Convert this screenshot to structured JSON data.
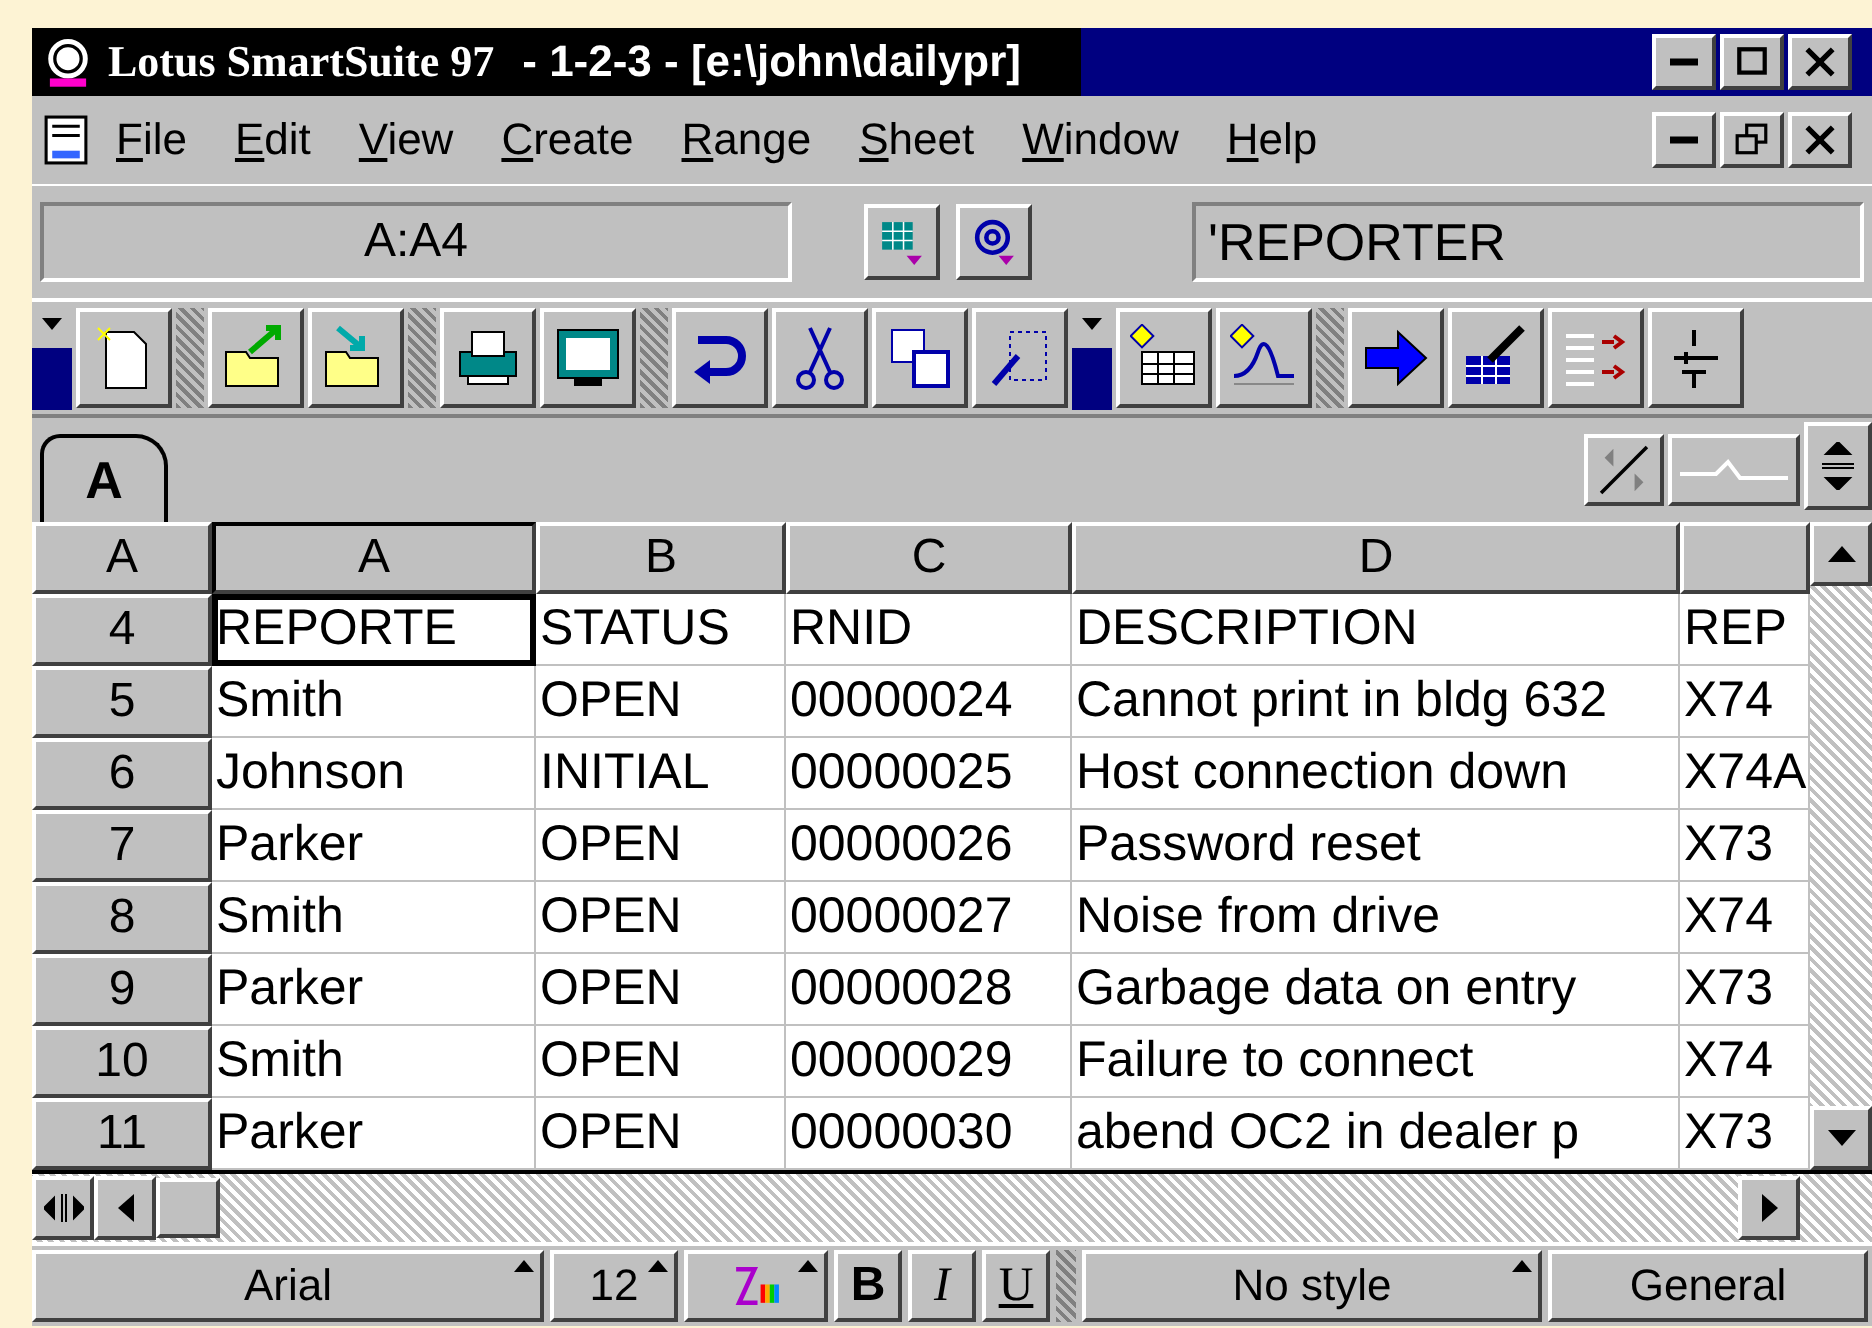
{
  "window": {
    "app": "Lotus SmartSuite 97",
    "document": "-  1-2-3 - [e:\\john\\dailypr]"
  },
  "menu": [
    "File",
    "Edit",
    "View",
    "Create",
    "Range",
    "Sheet",
    "Window",
    "Help"
  ],
  "edit_line": {
    "address": "A:A4",
    "contents": "'REPORTER"
  },
  "tabs": [
    {
      "label": "A",
      "selected": true
    }
  ],
  "sheet": {
    "corner": "A",
    "columns": [
      {
        "label": "A",
        "selected": true
      },
      {
        "label": "B",
        "selected": false
      },
      {
        "label": "C",
        "selected": false
      },
      {
        "label": "D",
        "selected": false
      },
      {
        "selected": false
      }
    ],
    "rows": [
      {
        "number": "4",
        "cells": [
          {
            "text": "REPORTE",
            "selected": true
          },
          {
            "text": "STATUS",
            "selected": false
          },
          {
            "text": "RNID",
            "selected": false
          },
          {
            "text": "DESCRIPTION",
            "selected": false
          },
          {
            "text": "REP",
            "selected": false
          }
        ]
      },
      {
        "number": "5",
        "cells": [
          {
            "text": "Smith",
            "selected": false
          },
          {
            "text": "OPEN",
            "selected": false
          },
          {
            "text": "00000024",
            "selected": false
          },
          {
            "text": "Cannot print in bldg 632",
            "selected": false
          },
          {
            "text": "X74",
            "selected": false
          }
        ]
      },
      {
        "number": "6",
        "cells": [
          {
            "text": "Johnson",
            "selected": false
          },
          {
            "text": "INITIAL",
            "selected": false
          },
          {
            "text": "00000025",
            "selected": false
          },
          {
            "text": "Host connection down",
            "selected": false
          },
          {
            "text": "X74A",
            "selected": false
          }
        ]
      },
      {
        "number": "7",
        "cells": [
          {
            "text": "Parker",
            "selected": false
          },
          {
            "text": "OPEN",
            "selected": false
          },
          {
            "text": "00000026",
            "selected": false
          },
          {
            "text": "Password reset",
            "selected": false
          },
          {
            "text": "X73",
            "selected": false
          }
        ]
      },
      {
        "number": "8",
        "cells": [
          {
            "text": "Smith",
            "selected": false
          },
          {
            "text": "OPEN",
            "selected": false
          },
          {
            "text": "00000027",
            "selected": false
          },
          {
            "text": "Noise from drive",
            "selected": false
          },
          {
            "text": "X74",
            "selected": false
          }
        ]
      },
      {
        "number": "9",
        "cells": [
          {
            "text": "Parker",
            "selected": false
          },
          {
            "text": "OPEN",
            "selected": false
          },
          {
            "text": "00000028",
            "selected": false
          },
          {
            "text": "Garbage data on entry",
            "selected": false
          },
          {
            "text": "X73",
            "selected": false
          }
        ]
      },
      {
        "number": "10",
        "cells": [
          {
            "text": "Smith",
            "selected": false
          },
          {
            "text": "OPEN",
            "selected": false
          },
          {
            "text": "00000029",
            "selected": false
          },
          {
            "text": "Failure to connect",
            "selected": false
          },
          {
            "text": "X74",
            "selected": false
          }
        ]
      },
      {
        "number": "11",
        "cells": [
          {
            "text": "Parker",
            "selected": false
          },
          {
            "text": "OPEN",
            "selected": false
          },
          {
            "text": "00000030",
            "selected": false
          },
          {
            "text": "abend OC2 in dealer p",
            "selected": false
          },
          {
            "text": "X73",
            "selected": false
          }
        ]
      }
    ]
  },
  "status_bar": {
    "font": "Arial",
    "size": "12",
    "bold": "B",
    "italic": "I",
    "underline": "U",
    "style": "No style",
    "format": "General"
  }
}
